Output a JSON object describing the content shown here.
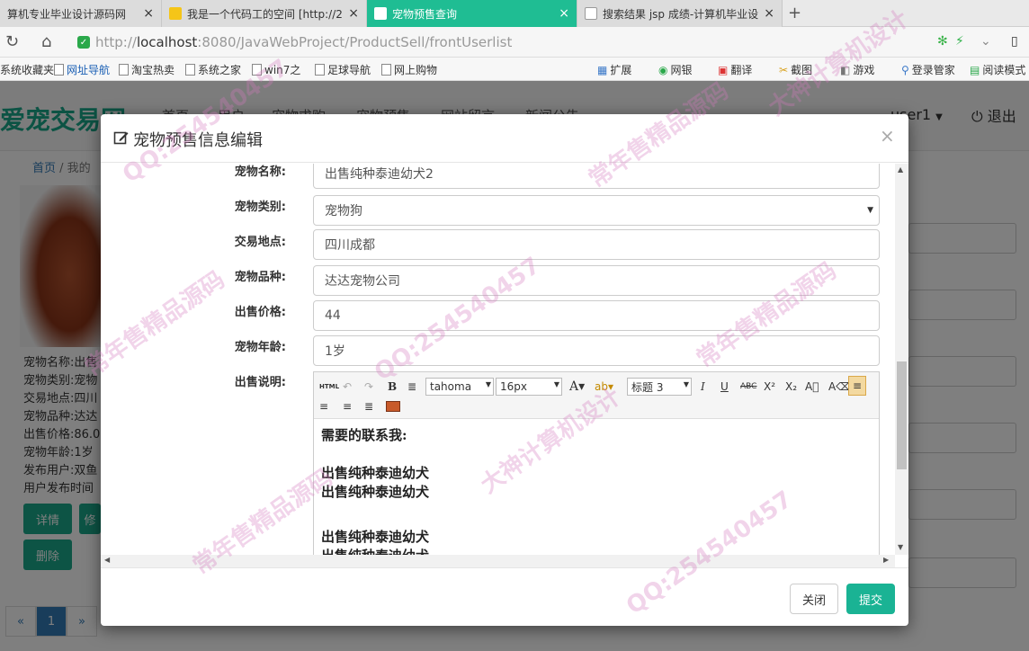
{
  "browser": {
    "tabs": [
      {
        "title": "算机专业毕业设计源码网",
        "active": false
      },
      {
        "title": "我是一个代码工的空间 [http://2",
        "active": false
      },
      {
        "title": "宠物预售查询",
        "active": true
      },
      {
        "title": "搜索结果 jsp 成绩-计算机毕业设",
        "active": false
      }
    ],
    "url_scheme": "http://",
    "url_host": "localhost",
    "url_rest": ":8080/JavaWebProject/ProductSell/frontUserlist",
    "bookmarks": [
      "系统收藏夹",
      "网址导航",
      "淘宝热卖",
      "系统之家",
      "win7之",
      "足球导航",
      "网上购物",
      "扩展",
      "网银",
      "翻译",
      "截图",
      "游戏",
      "登录管家",
      "阅读模式"
    ]
  },
  "site": {
    "logo": "爱宠交易网",
    "menu": [
      "首页",
      "用户",
      "宠物求购",
      "宠物预售",
      "网站留言",
      "新闻公告"
    ],
    "user": "user1",
    "logout": "退出",
    "breadcrumb_home": "首页",
    "breadcrumb_current": "我的",
    "pet_info": [
      "宠物名称:出售",
      "宠物类别:宠物",
      "交易地点:四川",
      "宠物品种:达达",
      "出售价格:86.0",
      "宠物年龄:1岁",
      "发布用户:双鱼",
      "用户发布时间"
    ],
    "btn_detail": "详情",
    "btn_modify": "修",
    "btn_delete": "删除",
    "pager_prev": "«",
    "pager_page": "1",
    "pager_next": "»"
  },
  "modal": {
    "title": "宠物预售信息编辑",
    "close_glyph": "×",
    "fields": {
      "pet_name": {
        "label": "宠物名称:",
        "value": "出售纯种泰迪幼犬2"
      },
      "pet_class": {
        "label": "宠物类别:",
        "value": "宠物狗"
      },
      "address": {
        "label": "交易地点:",
        "value": "四川成都"
      },
      "breed": {
        "label": "宠物品种:",
        "value": "达达宠物公司"
      },
      "price": {
        "label": "出售价格:",
        "value": "44"
      },
      "age": {
        "label": "宠物年龄:",
        "value": "1岁"
      },
      "desc": {
        "label": "出售说明:"
      }
    },
    "editor": {
      "toolbar": {
        "html": "HTML",
        "font_family": "tahoma",
        "font_size": "16px",
        "heading": "标题 3"
      },
      "content": [
        "需要的联系我:",
        "",
        "出售纯种泰迪幼犬",
        "出售纯种泰迪幼犬",
        "",
        "",
        "出售纯种泰迪幼犬",
        "出售纯种泰迪幼犬"
      ]
    },
    "btn_close": "关闭",
    "btn_submit": "提交"
  },
  "watermark": {
    "texts": [
      "QQ:254540457",
      "常年售精品源码",
      "大神计算机设计"
    ]
  },
  "colors": {
    "accent": "#1ab394",
    "active_tab": "#1fbd93"
  }
}
